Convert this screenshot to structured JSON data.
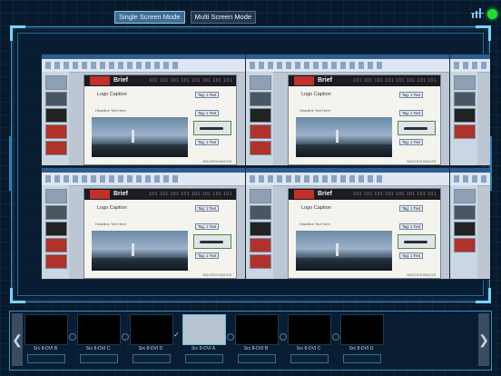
{
  "header": {
    "modes": [
      {
        "label": "Single Screen Mode",
        "active": true
      },
      {
        "label": "Multi Screen Mode",
        "active": false
      }
    ],
    "status_color": "#22dd33"
  },
  "slide": {
    "brand": "Brief",
    "url": "101 101 101 101  101 101 101 101",
    "logo_caption": "Logo Caption",
    "sub_caption": "Headline Text Here",
    "tag_top": "Tag: 1 Text",
    "tag_mid": "Tag: 1 Text",
    "tag_bot": "Tag: 1 Text",
    "footer": "MAGENIMAGE"
  },
  "sources": [
    {
      "name": "Src 8-DVI B",
      "active": false,
      "marker": "none"
    },
    {
      "name": "Src 8-DVI C",
      "active": false,
      "marker": "ring"
    },
    {
      "name": "Src 8-DVI D",
      "active": false,
      "marker": "ring"
    },
    {
      "name": "Src 8-DVI A",
      "active": true,
      "marker": "check"
    },
    {
      "name": "Src 8-DVI B",
      "active": false,
      "marker": "ring"
    },
    {
      "name": "Src 8-DVI C",
      "active": false,
      "marker": "ring"
    },
    {
      "name": "Src 8-DVI D",
      "active": false,
      "marker": "ring"
    }
  ],
  "nav": {
    "left": "❮",
    "right": "❯"
  }
}
